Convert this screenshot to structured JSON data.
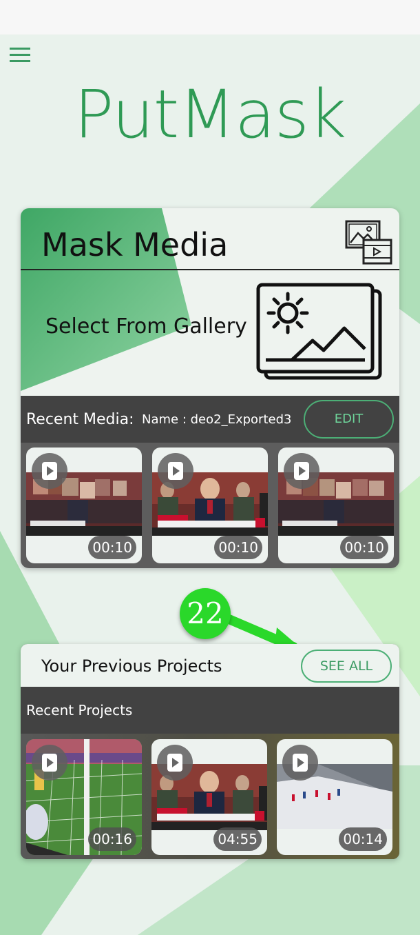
{
  "app": {
    "title": "PutMask",
    "accent_color": "#2f9a55"
  },
  "mask_media": {
    "title": "Mask Media",
    "gallery_label": "Select From Gallery",
    "recent_label": "Recent Media:",
    "recent_name": "Name : deo2_Exported3",
    "edit_label": "EDIT",
    "thumbnails": [
      {
        "duration": "00:10",
        "kind": "news-pixelated"
      },
      {
        "duration": "00:10",
        "kind": "news"
      },
      {
        "duration": "00:10",
        "kind": "news-pixelated"
      }
    ]
  },
  "projects": {
    "title": "Your Previous Projects",
    "see_all_label": "SEE ALL",
    "recent_label": "Recent Projects",
    "thumbnails": [
      {
        "duration": "00:16",
        "kind": "soccer"
      },
      {
        "duration": "04:55",
        "kind": "news"
      },
      {
        "duration": "00:14",
        "kind": "ski"
      }
    ]
  },
  "annotation": {
    "step_number": "22",
    "color": "#2ad82a"
  },
  "icons": {
    "menu": "hamburger-menu-icon",
    "media": "image-video-icon",
    "gallery": "gallery-image-icon",
    "play": "play-icon"
  }
}
